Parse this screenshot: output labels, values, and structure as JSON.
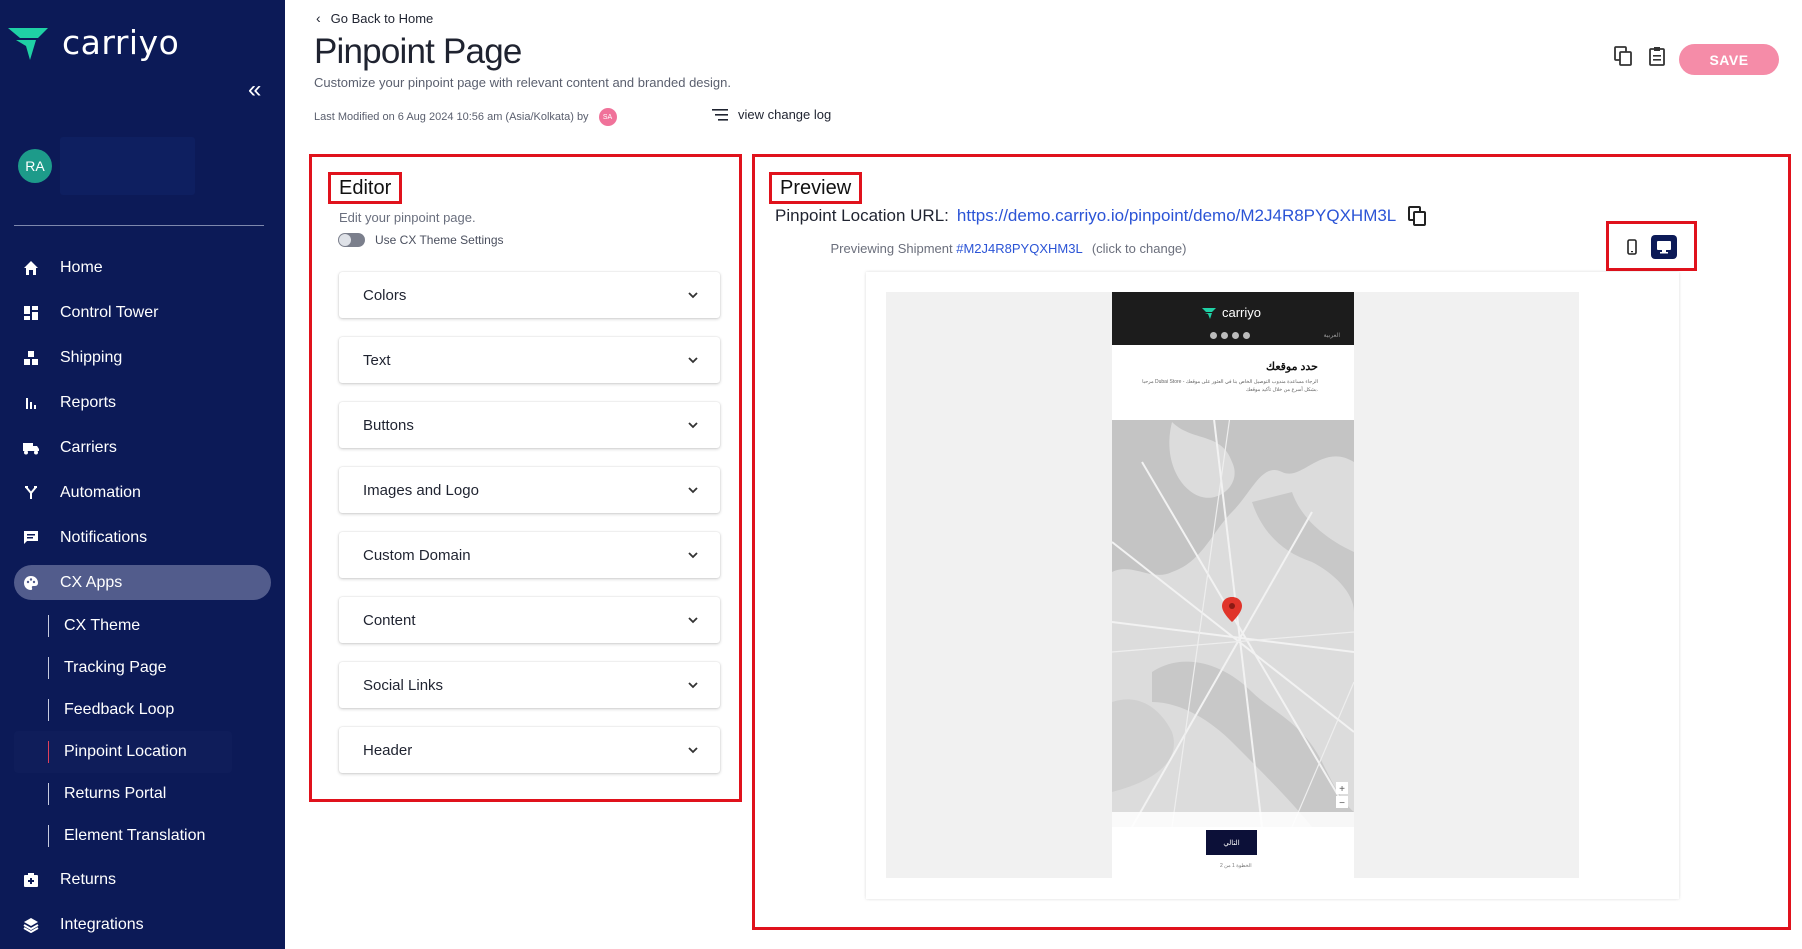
{
  "brand": {
    "name": "carriyo",
    "accent": "#1fd1a5",
    "sidebar_bg": "#0c1a57",
    "save_color": "#f58ca8",
    "highlight": "#e0121c"
  },
  "user": {
    "initials": "RA"
  },
  "sidebar": {
    "items": [
      {
        "label": "Home",
        "icon": "home-icon"
      },
      {
        "label": "Control Tower",
        "icon": "dashboard-icon"
      },
      {
        "label": "Shipping",
        "icon": "boxes-icon"
      },
      {
        "label": "Reports",
        "icon": "bar-chart-icon"
      },
      {
        "label": "Carriers",
        "icon": "truck-icon"
      },
      {
        "label": "Automation",
        "icon": "fork-icon"
      },
      {
        "label": "Notifications",
        "icon": "chat-icon"
      },
      {
        "label": "CX Apps",
        "icon": "palette-icon"
      }
    ],
    "sub_items": [
      {
        "label": "CX Theme"
      },
      {
        "label": "Tracking Page"
      },
      {
        "label": "Feedback Loop"
      },
      {
        "label": "Pinpoint Location"
      },
      {
        "label": "Returns Portal"
      },
      {
        "label": "Element Translation"
      }
    ],
    "bottom_items": [
      {
        "label": "Returns",
        "icon": "returns-icon"
      },
      {
        "label": "Integrations",
        "icon": "layers-icon"
      }
    ]
  },
  "header": {
    "back_label": "Go Back to Home",
    "title": "Pinpoint Page",
    "subtitle": "Customize your pinpoint page with relevant content and branded design.",
    "modified": "Last Modified on 6 Aug 2024 10:56 am (Asia/Kolkata) by",
    "modified_by": "SA",
    "change_log": "view change log",
    "save_label": "SAVE"
  },
  "editor": {
    "title": "Editor",
    "description": "Edit your pinpoint page.",
    "toggle_label": "Use CX Theme Settings",
    "toggle_on": false,
    "sections": [
      "Colors",
      "Text",
      "Buttons",
      "Images and Logo",
      "Custom Domain",
      "Content",
      "Social Links",
      "Header"
    ]
  },
  "preview": {
    "title": "Preview",
    "url_label": "Pinpoint Location URL:",
    "url": "https://demo.carriyo.io/pinpoint/demo/M2J4R8PYQXHM3L",
    "shipment_label": "Previewing Shipment",
    "shipment_id": "#M2J4R8PYQXHM3L",
    "shipment_hint": "(click to change)",
    "device_selected": "desktop",
    "mini": {
      "brand": "carriyo",
      "lang": "العربية",
      "heading": "حدد موقعك",
      "text": "مرحبا Dubai Store - الرجاء مساعدة مندوب التوصيل الخاص بنا في العثور على موقعك بشكل أسرع من خلال تأكيد موقعك.",
      "next": "التالي",
      "step": "الخطوة 1 من 2"
    }
  }
}
